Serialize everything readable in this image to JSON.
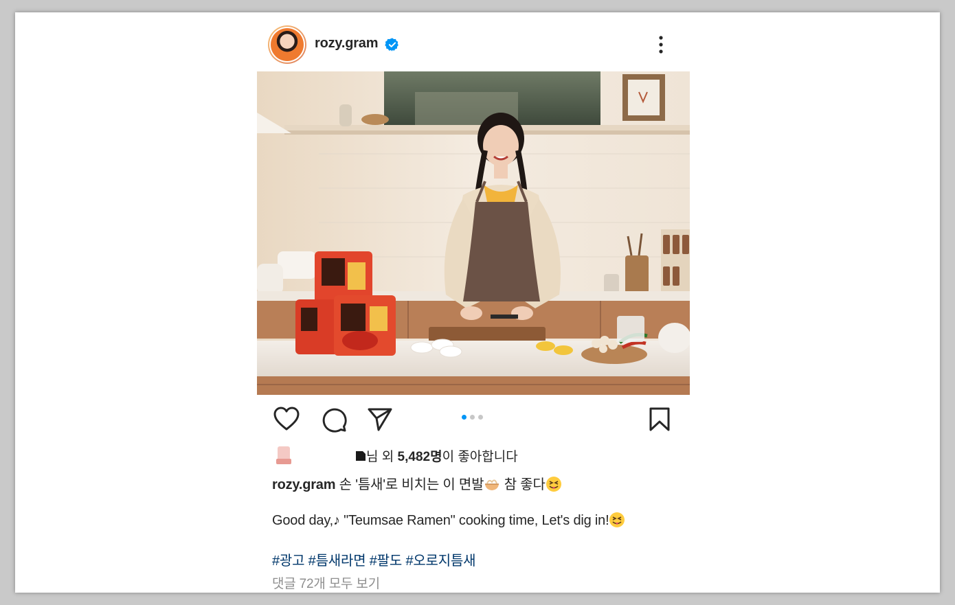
{
  "post": {
    "username": "rozy.gram",
    "verified": true,
    "menu_icon": "more-vertical-icon",
    "carousel": {
      "total": 3,
      "active_index": 0
    },
    "likes": {
      "prefix": "님 외 ",
      "count": "5,482명",
      "suffix": "이 좋아합니다"
    },
    "caption": {
      "username": "rozy.gram",
      "korean_part1": " 손 '틈새'로 비치는 이 면발",
      "korean_part2": " 참 좋다",
      "english": "Good day,♪ \"Teumsae Ramen\" cooking time, Let's dig in!",
      "hashtags": "#광고 #틈새라면 #팔도 #오로지틈새"
    },
    "view_comments": "댓글 72개 모두 보기",
    "colors": {
      "link": "#00376b",
      "muted": "#8e8e8e",
      "verified": "#0095f6",
      "active_dot": "#0095f6"
    }
  }
}
